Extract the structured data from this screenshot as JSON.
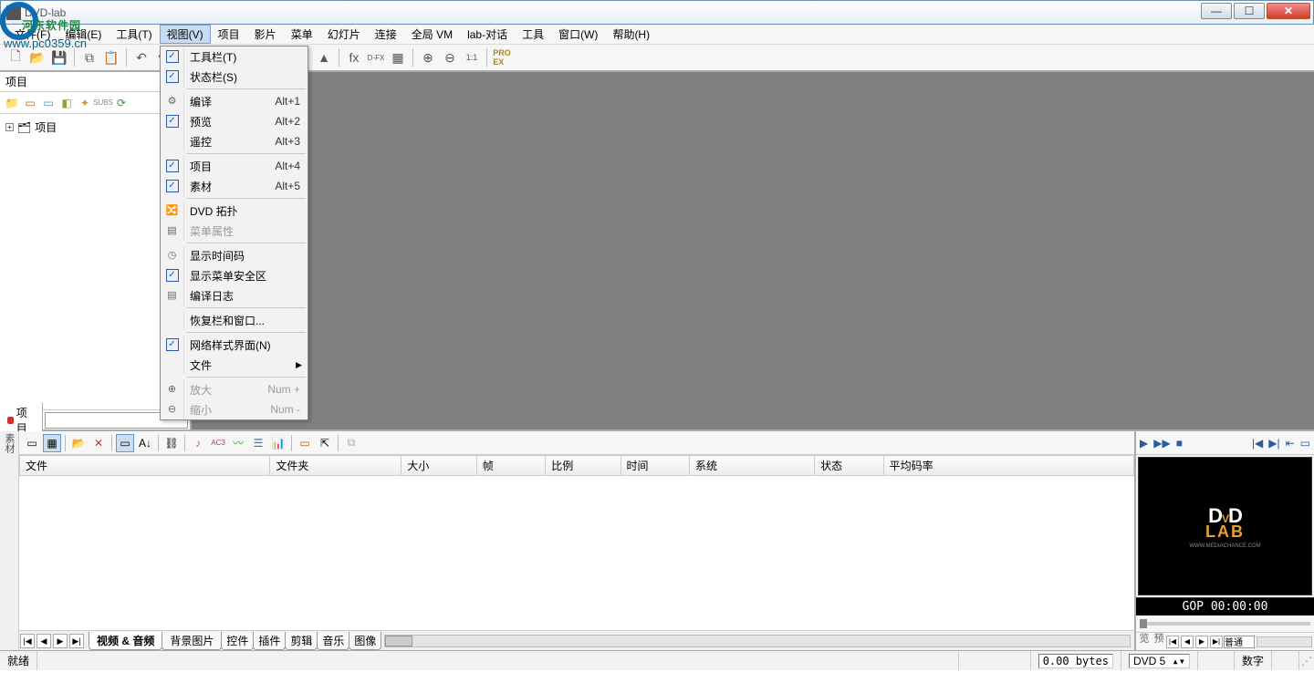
{
  "app": {
    "title": "DVD-lab"
  },
  "watermark": {
    "text": "河东软件园",
    "url": "www.pc0359.cn"
  },
  "menubar": [
    "文件(F)",
    "编辑(E)",
    "工具(T)",
    "视图(V)",
    "项目",
    "影片",
    "菜单",
    "幻灯片",
    "连接",
    "全局 VM",
    "lab-对话",
    "工具",
    "窗口(W)",
    "帮助(H)"
  ],
  "menubar_active_index": 3,
  "dropdown": [
    {
      "type": "item",
      "label": "工具栏(T)",
      "checked": true
    },
    {
      "type": "item",
      "label": "状态栏(S)",
      "checked": true
    },
    {
      "type": "div"
    },
    {
      "type": "item",
      "label": "编译",
      "accel": "Alt+1",
      "icon": "⚙"
    },
    {
      "type": "item",
      "label": "预览",
      "accel": "Alt+2",
      "checked": true
    },
    {
      "type": "item",
      "label": "遥控",
      "accel": "Alt+3"
    },
    {
      "type": "div"
    },
    {
      "type": "item",
      "label": "项目",
      "accel": "Alt+4",
      "checked": true
    },
    {
      "type": "item",
      "label": "素材",
      "accel": "Alt+5",
      "checked": true
    },
    {
      "type": "div"
    },
    {
      "type": "item",
      "label": "DVD 拓扑",
      "icon": "🔀"
    },
    {
      "type": "item",
      "label": "菜单属性",
      "icon": "▤",
      "disabled": true
    },
    {
      "type": "div"
    },
    {
      "type": "item",
      "label": "显示时间码",
      "icon": "◷"
    },
    {
      "type": "item",
      "label": "显示菜单安全区",
      "checked": true
    },
    {
      "type": "item",
      "label": "编译日志",
      "icon": "▤"
    },
    {
      "type": "div"
    },
    {
      "type": "item",
      "label": "恢复栏和窗口..."
    },
    {
      "type": "div"
    },
    {
      "type": "item",
      "label": "网络样式界面(N)",
      "checked": true
    },
    {
      "type": "item",
      "label": "文件",
      "submenu": true
    },
    {
      "type": "div"
    },
    {
      "type": "item",
      "label": "放大",
      "accel": "Num +",
      "icon": "⊕",
      "disabled": true
    },
    {
      "type": "item",
      "label": "缩小",
      "accel": "Num -",
      "icon": "⊖",
      "disabled": true
    }
  ],
  "project": {
    "title": "项目",
    "root": "项目",
    "tab": "项目"
  },
  "assets": {
    "columns": [
      "文件",
      "文件夹",
      "大小",
      "帧",
      "比例",
      "时间",
      "系统",
      "状态",
      "平均码率"
    ],
    "tabs": [
      "视频 & 音频",
      "背景图片",
      "控件",
      "插件",
      "剪辑",
      "音乐",
      "图像"
    ],
    "active_tab": 0,
    "vlabel": "素材"
  },
  "preview": {
    "logo_top": "DVD",
    "logo_bottom": "LAB",
    "logo_sub": "WWW.MEDIACHANCE.COM",
    "gop": "GOP 00:00:00",
    "mode": "普通",
    "vlabel": "预览"
  },
  "status": {
    "ready": "就绪",
    "bytes": "0.00 bytes",
    "disc": "DVD 5",
    "num": "数字"
  }
}
